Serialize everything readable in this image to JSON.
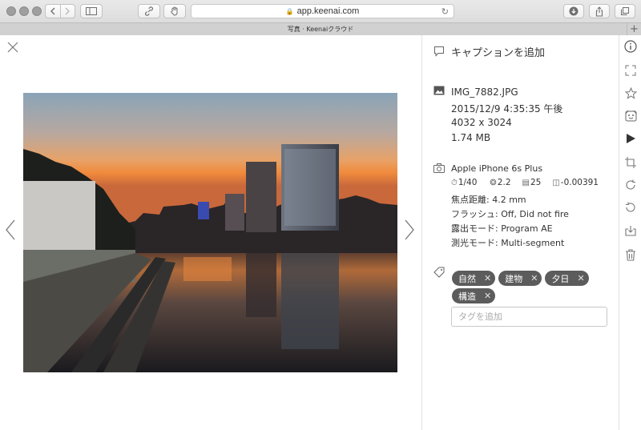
{
  "browser": {
    "url": "app.keenai.com",
    "tab_title": "写真 · Keenaiクラウド"
  },
  "photo": {
    "filename": "IMG_7882.JPG",
    "datetime": "2015/12/9 4:35:35 午後",
    "dimensions": "4032 x 3024",
    "filesize": "1.74 MB"
  },
  "panel": {
    "caption_prompt": "キャプションを追加",
    "camera": "Apple iPhone 6s Plus",
    "exif": {
      "shutter": "1/40",
      "aperture": "2.2",
      "iso": "25",
      "exposure_bias": "-0.00391"
    },
    "focal_length": "焦点距離: 4.2 mm",
    "flash": "フラッシュ: Off, Did not fire",
    "exposure_mode": "露出モード: Program AE",
    "metering_mode": "測光モード: Multi-segment",
    "tags": [
      "自然",
      "建物",
      "夕日",
      "構造"
    ],
    "tag_placeholder": "タグを追加"
  },
  "toolbar": {
    "icons": [
      "info-icon",
      "fullscreen-icon",
      "star-icon",
      "face-icon",
      "play-icon",
      "crop-icon",
      "rotate-right-icon",
      "rotate-left-icon",
      "download-icon",
      "trash-icon"
    ]
  },
  "colors": {
    "tag_bg": "#5c5c5c",
    "icon": "#777777"
  }
}
